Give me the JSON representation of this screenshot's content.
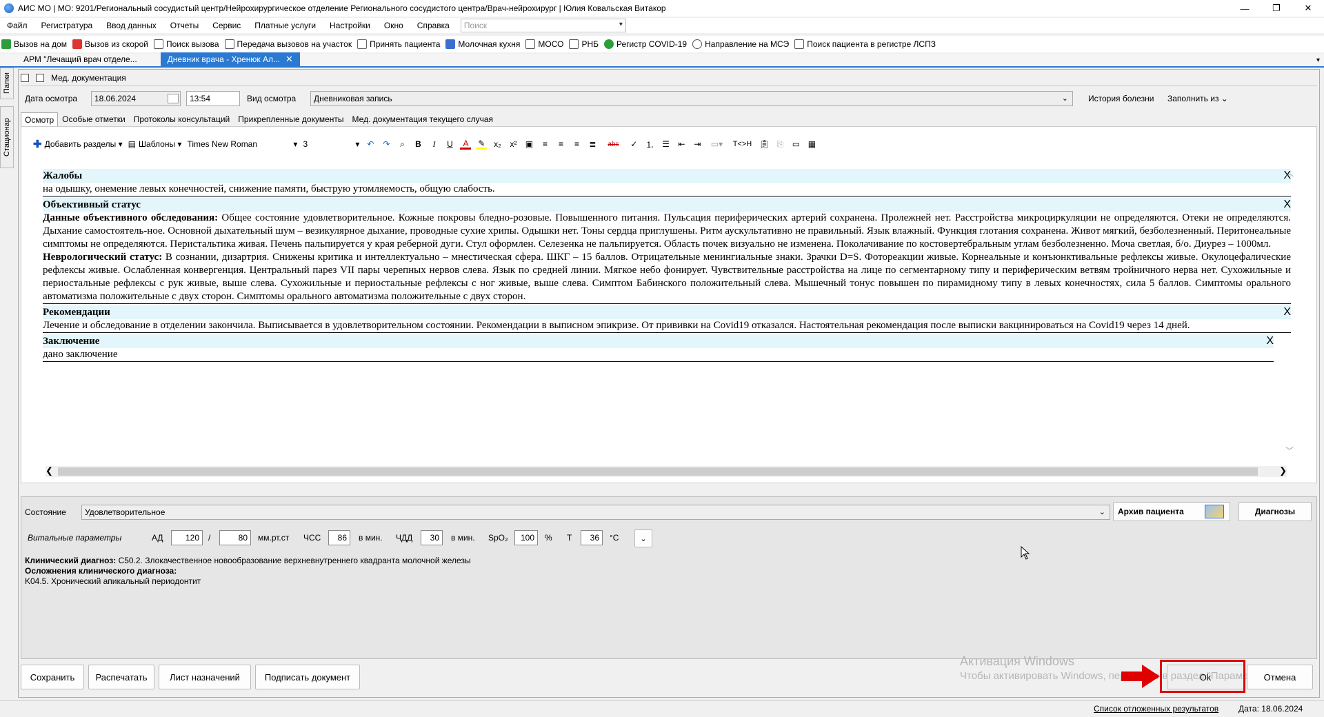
{
  "window": {
    "title": "АИС МО | МО: 9201/Региональный сосудистый центр/Нейрохирургическое отделение Регионального сосудистого центра/Врач-нейрохирург | Юлия Ковальская Витакор",
    "minimize": "—",
    "maximize": "❐",
    "close": "✕"
  },
  "menu": {
    "items": [
      "Файл",
      "Регистратура",
      "Ввод данных",
      "Отчеты",
      "Сервис",
      "Платные услуги",
      "Настройки",
      "Окно",
      "Справка"
    ],
    "search_placeholder": "Поиск"
  },
  "toolbar": {
    "items": [
      {
        "label": "Вызов на дом",
        "color": "#2e9e3a"
      },
      {
        "label": "Вызов из скорой",
        "color": "#d33"
      },
      {
        "label": "Поиск вызова",
        "color": "#555"
      },
      {
        "label": "Передача вызовов на участок",
        "color": "#555"
      },
      {
        "label": "Принять пациента",
        "color": "#666"
      },
      {
        "label": "Молочная кухня",
        "color": "#3a6fd0"
      },
      {
        "label": "МОСО",
        "color": "#555"
      },
      {
        "label": "РНБ",
        "color": "#555"
      },
      {
        "label": "Регистр COVID-19",
        "color": "#2e9e3a"
      },
      {
        "label": "Направление на МСЭ",
        "color": "#555"
      },
      {
        "label": "Поиск пациента в регистре ЛСПЗ",
        "color": "#555"
      }
    ]
  },
  "doc_tabs": [
    {
      "label": "АРМ \"Лечащий врач отделе...",
      "active": false
    },
    {
      "label": "Дневник врача - Хренюк Ал...",
      "active": true,
      "close": "✕"
    }
  ],
  "side_tabs": [
    "Папки",
    "Стационар"
  ],
  "doc_toolbar": {
    "label": "Мед. документация"
  },
  "form": {
    "date_label": "Дата осмотра",
    "date_value": "18.06.2024",
    "time_value": "13:54",
    "type_label": "Вид осмотра",
    "type_value": "Дневниковая  запись",
    "history_label": "История болезни",
    "fill_label": "Заполнить из"
  },
  "sub_tabs": [
    {
      "label": "Осмотр",
      "active": true
    },
    {
      "label": "Особые отметки",
      "active": false
    },
    {
      "label": "Протоколы консультаций",
      "active": false
    },
    {
      "label": "Прикрепленные документы",
      "active": false
    },
    {
      "label": "Мед. документация текущего случая",
      "active": false
    }
  ],
  "editor_toolbar": {
    "add_sections": "Добавить разделы",
    "templates": "Шаблоны",
    "font": "Times New Roman",
    "size": "3",
    "tcn": "T<>H"
  },
  "document": {
    "close_mark": "X",
    "sections": [
      {
        "heading": "Жалобы",
        "paragraphs": [
          {
            "bold": "",
            "text": "на одышку, онемение левых конечностей, снижение памяти, быструю утомляемость, общую слабость."
          }
        ]
      },
      {
        "heading": "Объективный статус",
        "paragraphs": [
          {
            "bold": "Данные объективного обследования:",
            "text": " Общее состояние удовлетворительное. Кожные покровы бледно-розовые. Повышенного питания. Пульсация периферических артерий сохранена. Пролежней нет. Расстройства микроциркуляции не определяются. Отеки не определяются. Дыхание самостоятель-ное. Основной дыхательный шум – везикулярное дыхание, проводные сухие хрипы. Одышки нет. Тоны сердца приглушены. Ритм аускультативно не правильный. Язык влажный. Функция глотания сохранена. Живот мягкий, безболезненный. Перитонеальные симптомы не определяются. Перистальтика живая. Печень пальпируется у края реберной дуги. Стул оформлен. Селезенка не пальпируется. Область почек визуально не изменена. Поколачивание по костовертебральным углам безболезненно. Моча светлая, б/о. Диурез – 1000мл."
          },
          {
            "bold": "Неврологический статус:",
            "text": " В сознании, дизартрия. Снижены критика и интеллектуально – мнестическая сфера. ШКГ – 15 баллов. Отрицательные менингиальные знаки. Зрачки D=S. Фотореакции живые. Корнеальные и конъюнктивальные рефлексы живые. Окулоцефалические рефлексы живые. Ослабленная конвергенция. Центральный парез VII пары черепных нервов слева. Язык по средней линии. Мягкое небо фонирует. Чувствительные расстройства на лице по сегментарному типу и периферическим ветвям тройничного нерва нет. Сухожильные и периостальные рефлексы с рук живые, выше слева. Сухожильные и периостальные рефлексы с ног живые, выше слева. Симптом Бабинского положительный слева. Мышечный тонус повышен по пирамидному типу в левых конечностях, сила 5 баллов. Симптомы орального автоматизма положительные с двух сторон. Симптомы орального автоматизма положительные с двух сторон."
          }
        ]
      },
      {
        "heading": "Рекомендации",
        "paragraphs": [
          {
            "bold": "",
            "text": "Лечение и обследование в отделении закончила. Выписывается в удовлетворительном  состоянии. Рекомендации в выписном эпикризе. От прививки  на Covid19 отказался. Настоятельная рекомендация после выписки вакцинироваться на Covid19 через 14 дней."
          }
        ]
      },
      {
        "heading": "Заключение",
        "paragraphs": [
          {
            "bold": "",
            "text": "дано заключение"
          }
        ]
      }
    ]
  },
  "bottom": {
    "state_label": "Состояние",
    "state_value": "Удовлетворительное",
    "archive_label": "Архив пациента",
    "diagnoses_label": "Диагнозы",
    "vitals_label": "Витальные параметры",
    "ad_label": "АД",
    "ad_sys": "120",
    "slash": "/",
    "ad_dia": "80",
    "ad_unit": "мм.рт.ст",
    "hr_label": "ЧСС",
    "hr_value": "86",
    "hr_unit": "в мин.",
    "rr_label": "ЧДД",
    "rr_value": "30",
    "rr_unit": "в мин.",
    "spo2_label": "SpO₂",
    "spo2_value": "100",
    "spo2_unit": "%",
    "temp_label": "Т",
    "temp_value": "36",
    "temp_unit": "°С",
    "clin_label": "Клинический диагноз:",
    "clin_value": " C50.2. Злокачественное новообразование верхневнутреннего квадранта молочной железы",
    "compl_label": "Осложнения клинического диагноза:",
    "compl_value": "K04.5. Хронический апикальный периодонтит"
  },
  "buttons": {
    "save": "Сохранить",
    "print": "Распечатать",
    "orders": "Лист назначений",
    "sign": "Подписать документ",
    "ok": "Ok",
    "cancel": "Отмена"
  },
  "watermark": {
    "line1": "Активация Windows",
    "line2": "Чтобы активировать Windows, перейдите в раздел \"Параметры\"."
  },
  "status": {
    "deferred": "Список отложенных результатов",
    "date": "Дата: 18.06.2024"
  },
  "colors": {
    "accent": "#2b79d0",
    "section_bg": "#e2f6fb",
    "highlight_box": "#e00000"
  }
}
